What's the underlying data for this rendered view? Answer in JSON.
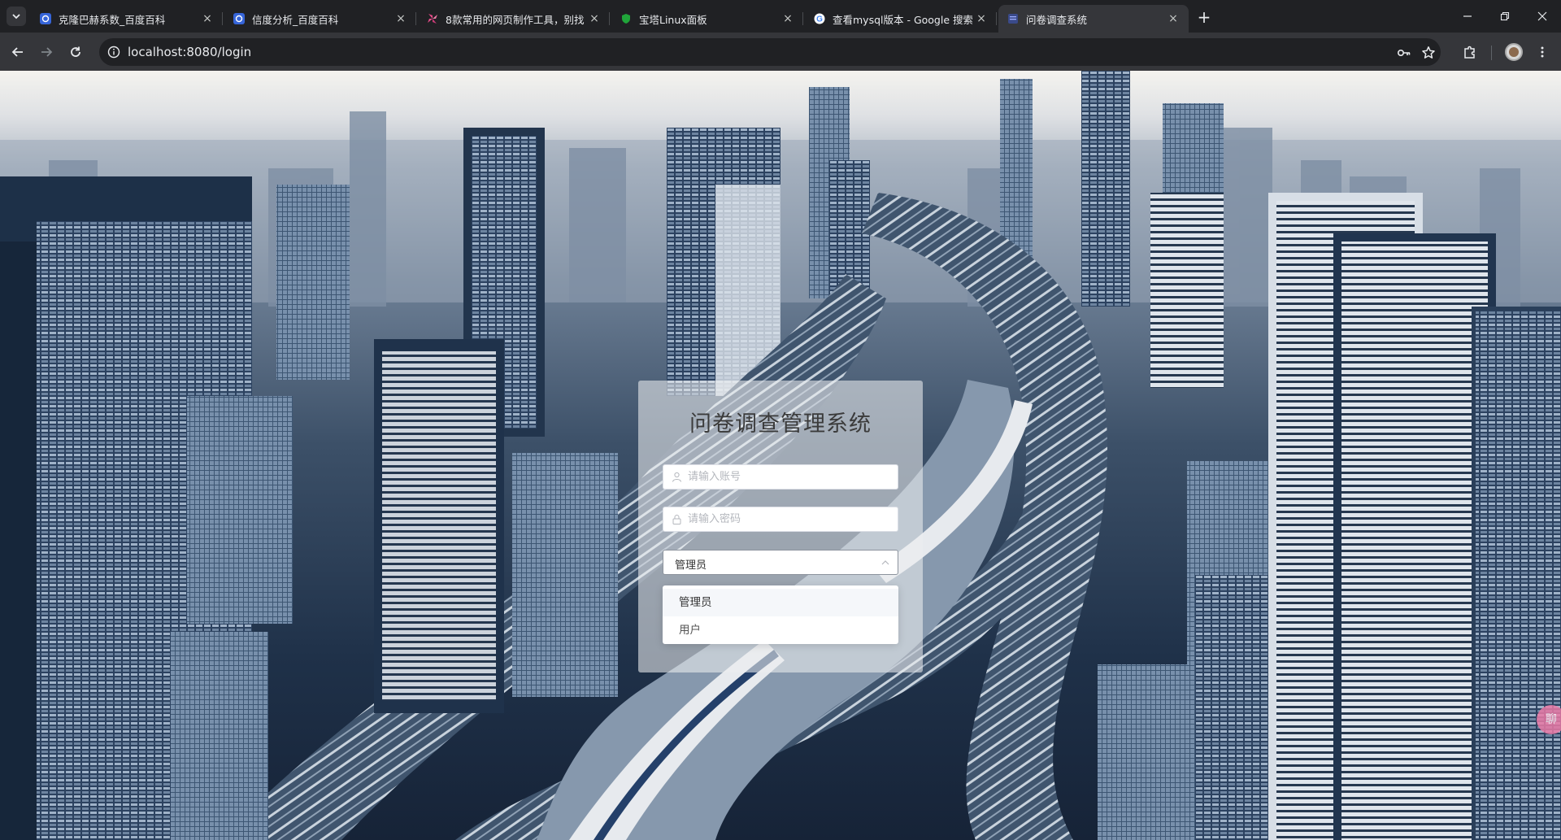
{
  "browser": {
    "tabs": [
      {
        "title": "克隆巴赫系数_百度百科",
        "favicon": "baidu-baike-icon"
      },
      {
        "title": "信度分析_百度百科",
        "favicon": "baidu-baike-icon"
      },
      {
        "title": "8款常用的网页制作工具，别找",
        "favicon": "pinwheel-icon"
      },
      {
        "title": "宝塔Linux面板",
        "favicon": "bt-panel-icon"
      },
      {
        "title": "查看mysql版本 - Google 搜索",
        "favicon": "google-icon"
      },
      {
        "title": "问卷调查系统",
        "favicon": "page-icon"
      }
    ],
    "active_tab_index": 5,
    "url": "localhost:8080/login",
    "close_glyph": "×",
    "new_tab_glyph": "+"
  },
  "login": {
    "title": "问卷调查管理系统",
    "username_placeholder": "请输入账号",
    "password_placeholder": "请输入密码",
    "role_selected": "管理员",
    "role_options": [
      "管理员",
      "用户"
    ]
  },
  "side_badge": "聊",
  "colors": {
    "tabstrip": "#202124",
    "toolbar": "#35363a",
    "omnibox": "#202124",
    "title_text": "#3b3b3b",
    "selected_option_bg": "#f5f7fa"
  }
}
